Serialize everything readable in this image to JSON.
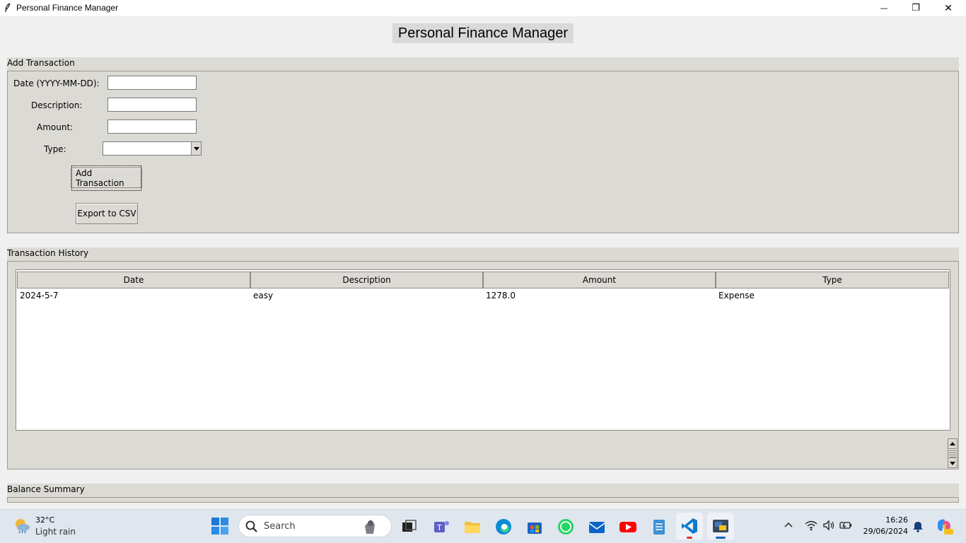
{
  "window": {
    "title": "Personal Finance Manager",
    "controls": {
      "minimize": "—",
      "maximize": "❐",
      "close": "✕"
    }
  },
  "app": {
    "heading": "Personal Finance Manager"
  },
  "add_transaction": {
    "title": "Add Transaction",
    "date_label": "Date (YYYY-MM-DD):",
    "date_value": "",
    "description_label": "Description:",
    "description_value": "",
    "amount_label": "Amount:",
    "amount_value": "",
    "type_label": "Type:",
    "type_value": "",
    "add_button": "Add Transaction",
    "export_button": "Export to CSV"
  },
  "history": {
    "title": "Transaction History",
    "columns": [
      "Date",
      "Description",
      "Amount",
      "Type"
    ],
    "rows": [
      [
        "2024-5-7",
        "easy",
        "1278.0",
        "Expense"
      ]
    ]
  },
  "balance": {
    "title": "Balance Summary"
  },
  "taskbar": {
    "weather_temp": "32°C",
    "weather_desc": "Light rain",
    "search_placeholder": "Search",
    "time": "16:26",
    "date": "29/06/2024",
    "icons": [
      "start-icon",
      "search-icon",
      "task-view-icon",
      "teams-icon",
      "file-explorer-icon",
      "edge-icon",
      "store-icon",
      "whatsapp-icon",
      "mail-icon",
      "youtube-icon",
      "notepad-icon",
      "vscode-icon",
      "python-app-icon"
    ],
    "colors": {
      "accent": "#0a64c8",
      "youtube": "#ff0000",
      "whatsapp": "#25d366"
    }
  }
}
